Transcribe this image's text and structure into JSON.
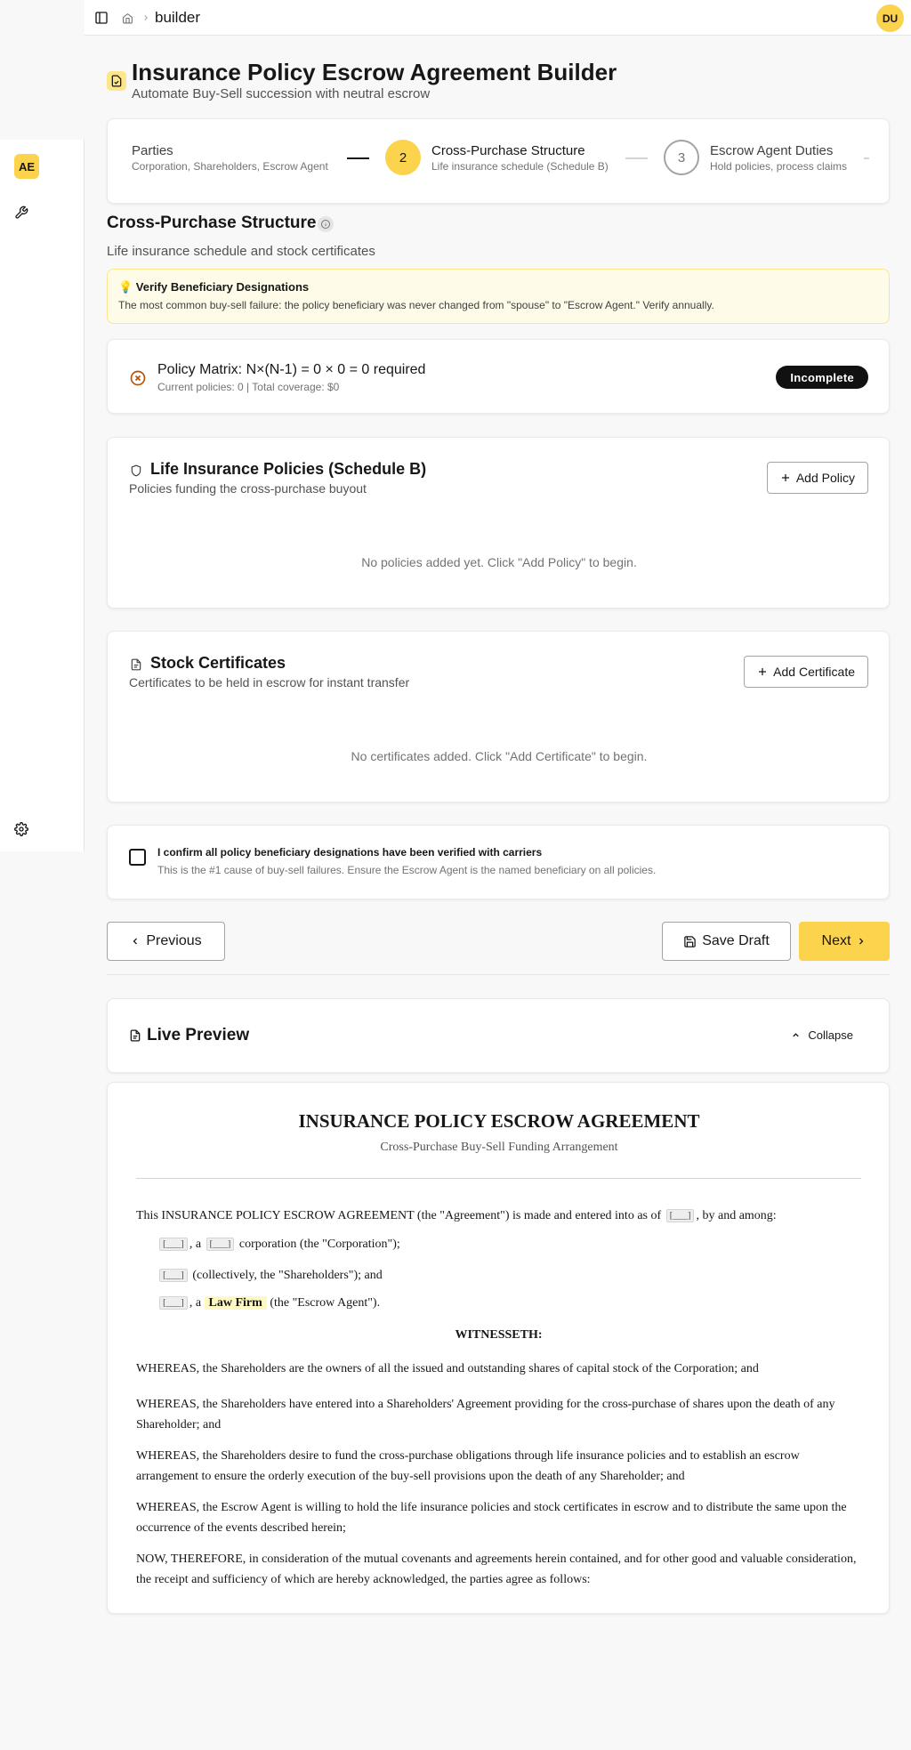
{
  "sidebar": {
    "logo": "AE",
    "tools_icon": "wrench-icon",
    "settings_icon": "gear-icon"
  },
  "header": {
    "breadcrumb": "builder",
    "avatar": "DU"
  },
  "page": {
    "title": "Insurance Policy Escrow Agreement Builder",
    "subtitle": "Automate Buy-Sell succession with neutral escrow"
  },
  "stepper": {
    "steps": [
      {
        "title": "Parties",
        "desc": "Corporation, Shareholders, Escrow Agent",
        "number": ""
      },
      {
        "title": "Cross-Purchase Structure",
        "desc": "Life insurance schedule (Schedule B)",
        "number": "2"
      },
      {
        "title": "Escrow Agent Duties",
        "desc": "Hold policies, process claims",
        "number": "3"
      }
    ]
  },
  "section": {
    "title": "Cross-Purchase Structure",
    "subtitle": "Life insurance schedule and stock certificates"
  },
  "alert": {
    "title": "💡 Verify Beneficiary Designations",
    "text": "The most common buy-sell failure: the policy beneficiary was never changed from \"spouse\" to \"Escrow Agent.\" Verify annually."
  },
  "matrix": {
    "title": "Policy Matrix: N×(N-1) = 0 × 0 = 0 required",
    "sub": "Current policies: 0 | Total coverage: $0",
    "badge": "Incomplete"
  },
  "policies": {
    "title": "Life Insurance Policies (Schedule B)",
    "sub": "Policies funding the cross-purchase buyout",
    "button": "Add Policy",
    "empty": "No policies added yet. Click \"Add Policy\" to begin."
  },
  "certificates": {
    "title": "Stock Certificates",
    "sub": "Certificates to be held in escrow for instant transfer",
    "button": "Add Certificate",
    "empty": "No certificates added. Click \"Add Certificate\" to begin."
  },
  "confirm": {
    "label": "I confirm all policy beneficiary designations have been verified with carriers",
    "hint": "This is the #1 cause of buy-sell failures. Ensure the Escrow Agent is the named beneficiary on all policies.",
    "checked": false
  },
  "nav": {
    "previous": "Previous",
    "save": "Save Draft",
    "next": "Next"
  },
  "preview": {
    "title": "Live Preview",
    "collapse": "Collapse"
  },
  "document": {
    "title": "INSURANCE POLICY ESCROW AGREEMENT",
    "subtitle": "Cross-Purchase Buy-Sell Funding Arrangement",
    "blank": "[___]",
    "intro_a": "This INSURANCE POLICY ESCROW AGREEMENT (the \"Agreement\") is made and entered into as of",
    "intro_b": ", by and among:",
    "party1_a": ", a",
    "party1_b": "corporation (the \"Corporation\");",
    "party2": "(collectively, the \"Shareholders\"); and",
    "party3_a": ", a",
    "party3_firm": "Law Firm",
    "party3_b": "(the \"Escrow Agent\").",
    "witnesseth": "WITNESSETH:",
    "whereas": [
      "WHEREAS, the Shareholders are the owners of all the issued and outstanding shares of capital stock of the Corporation; and",
      "WHEREAS, the Shareholders have entered into a Shareholders' Agreement providing for the cross-purchase of shares upon the death of any Shareholder; and",
      "WHEREAS, the Shareholders desire to fund the cross-purchase obligations through life insurance policies and to establish an escrow arrangement to ensure the orderly execution of the buy-sell provisions upon the death of any Shareholder; and",
      "WHEREAS, the Escrow Agent is willing to hold the life insurance policies and stock certificates in escrow and to distribute the same upon the occurrence of the events described herein;",
      "NOW, THEREFORE, in consideration of the mutual covenants and agreements herein contained, and for other good and valuable consideration, the receipt and sufficiency of which are hereby acknowledged, the parties agree as follows:"
    ]
  },
  "colors": {
    "accent": "#fcd34d",
    "alert_bg": "#fefce8",
    "badge": "#111111"
  }
}
